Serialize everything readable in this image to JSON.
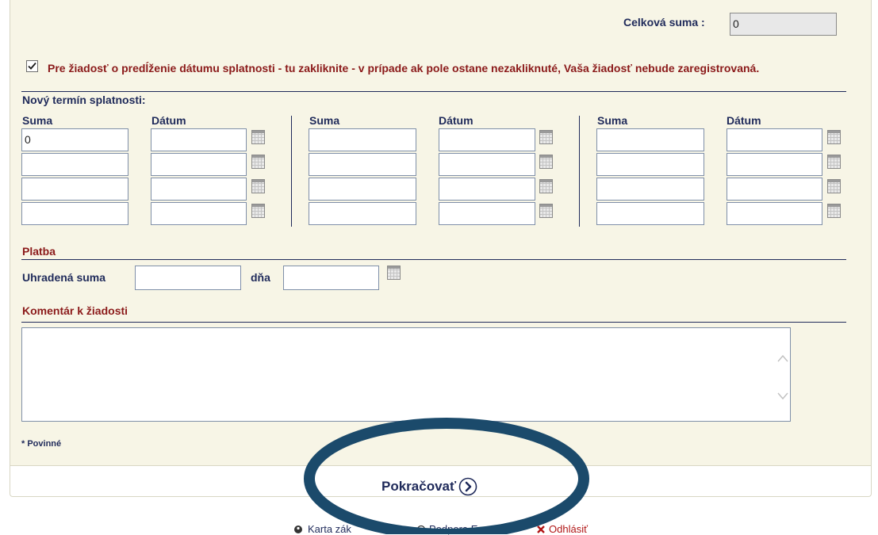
{
  "total": {
    "label": "Celková suma :",
    "value": "0"
  },
  "extension": {
    "checked": true,
    "text": "Pre žiadosť o predĺženie dátumu splatnosti - tu zakliknite - v prípade ak pole ostane nezakliknuté, Vaša žiadosť nebude zaregistrovaná."
  },
  "schedule": {
    "title": "Nový termín splatnosti:",
    "columns": [
      {
        "suma_label": "Suma",
        "datum_label": "Dátum",
        "sums": [
          "0",
          "",
          "",
          ""
        ],
        "dates": [
          "",
          "",
          "",
          ""
        ]
      },
      {
        "suma_label": "Suma",
        "datum_label": "Dátum",
        "sums": [
          "",
          "",
          "",
          ""
        ],
        "dates": [
          "",
          "",
          "",
          ""
        ]
      },
      {
        "suma_label": "Suma",
        "datum_label": "Dátum",
        "sums": [
          "",
          "",
          "",
          ""
        ],
        "dates": [
          "",
          "",
          "",
          ""
        ]
      }
    ]
  },
  "payment": {
    "title": "Platba",
    "amount_label": "Uhradená suma",
    "amount_value": "",
    "date_label": "dňa",
    "date_value": ""
  },
  "comment": {
    "title": "Komentár k žiadosti",
    "value": ""
  },
  "required_note": "* Povinné",
  "continue": {
    "label": "Pokračovať"
  },
  "bottom_nav": {
    "items": [
      {
        "label": "Karta zák",
        "icon": "user-card-icon"
      },
      {
        "label": "Podpora E",
        "icon": "support-icon"
      },
      {
        "label": "Odhlásiť",
        "icon": "logout-x-icon"
      }
    ]
  },
  "annotation": {
    "shape": "ellipse-highlight",
    "color": "#1b4a6b"
  }
}
